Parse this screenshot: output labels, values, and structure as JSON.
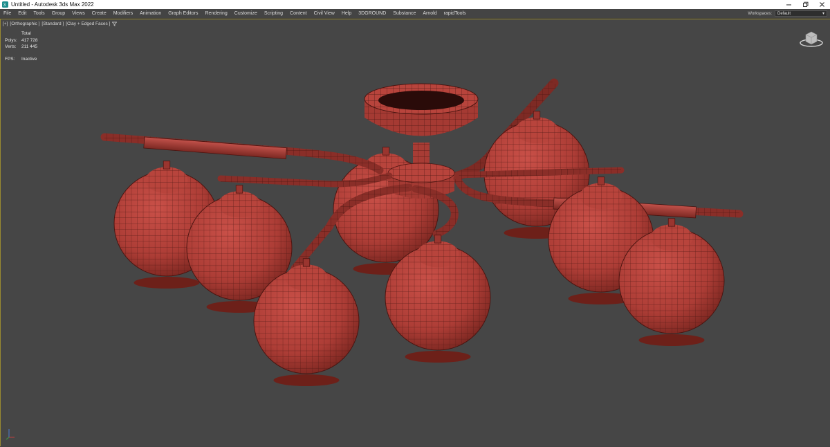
{
  "window": {
    "title": "Untitled - Autodesk 3ds Max 2022",
    "icon": "3dsmax-app-icon"
  },
  "menu": {
    "items": [
      "File",
      "Edit",
      "Tools",
      "Group",
      "Views",
      "Create",
      "Modifiers",
      "Animation",
      "Graph Editors",
      "Rendering",
      "Customize",
      "Scripting",
      "Content",
      "Civil View",
      "Help",
      "3DGROUND",
      "Substance",
      "Arnold",
      "rapidTools"
    ],
    "workspaces_label": "Workspaces:",
    "workspace_value": "Default"
  },
  "viewport": {
    "label_plus": "[+]",
    "label_view": "[Orthographic ]",
    "label_shading": "[Standard ]",
    "label_mode": "[Clay + Edged Faces ]",
    "filter_icon": "filter-icon"
  },
  "stats": {
    "header": "Total",
    "polys_label": "Polys:",
    "polys_value": "417 728",
    "verts_label": "Verts:",
    "verts_value": "211 445",
    "fps_label": "FPS:",
    "fps_value": "Inactive"
  },
  "colors": {
    "viewport_bg": "#464646",
    "clay": "#b8443c",
    "wire": "#5a1c18",
    "active_border": "#9a8a30"
  }
}
